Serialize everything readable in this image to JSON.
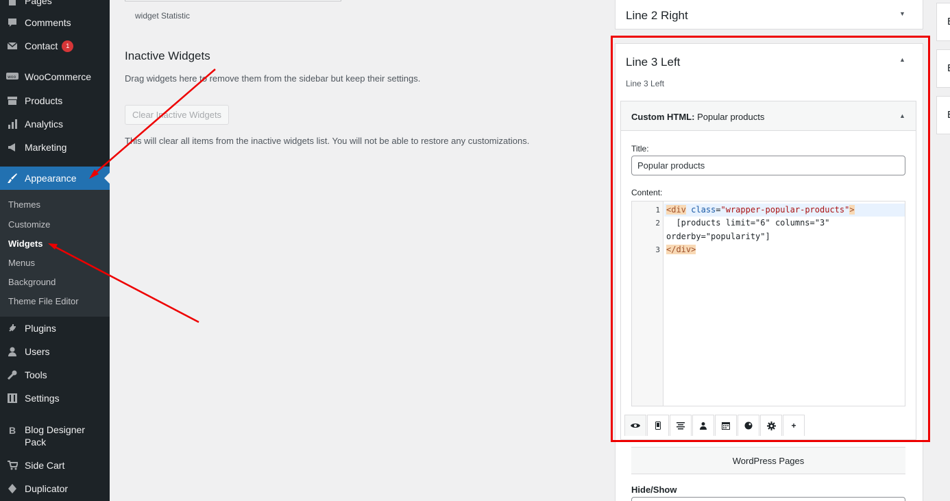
{
  "admin_menu": {
    "items": [
      {
        "key": "pages",
        "label": "Pages",
        "icon": "pages-icon"
      },
      {
        "key": "comments",
        "label": "Comments",
        "icon": "comment-icon"
      },
      {
        "key": "contact",
        "label": "Contact",
        "icon": "mail-icon",
        "badge": "1"
      },
      {
        "key": "woocommerce",
        "label": "WooCommerce",
        "icon": "woocommerce-icon"
      },
      {
        "key": "products",
        "label": "Products",
        "icon": "archive-icon"
      },
      {
        "key": "analytics",
        "label": "Analytics",
        "icon": "bar-chart-icon"
      },
      {
        "key": "marketing",
        "label": "Marketing",
        "icon": "megaphone-icon"
      },
      {
        "key": "appearance",
        "label": "Appearance",
        "icon": "paintbrush-icon",
        "active": true
      },
      {
        "key": "plugins",
        "label": "Plugins",
        "icon": "plug-icon"
      },
      {
        "key": "users",
        "label": "Users",
        "icon": "user-icon"
      },
      {
        "key": "tools",
        "label": "Tools",
        "icon": "wrench-icon"
      },
      {
        "key": "settings",
        "label": "Settings",
        "icon": "settings-icon"
      },
      {
        "key": "blog_designer",
        "label": "Blog Designer Pack",
        "icon": "b-letter-icon"
      },
      {
        "key": "side_cart",
        "label": "Side Cart",
        "icon": "cart-icon"
      },
      {
        "key": "duplicator",
        "label": "Duplicator",
        "icon": "duplicator-icon"
      }
    ],
    "submenu": [
      {
        "label": "Themes"
      },
      {
        "label": "Customize"
      },
      {
        "label": "Widgets",
        "current": true
      },
      {
        "label": "Menus"
      },
      {
        "label": "Background"
      },
      {
        "label": "Theme File Editor"
      }
    ]
  },
  "main": {
    "widget_desc": "widget Statistic",
    "inactive_title": "Inactive Widgets",
    "inactive_desc": "Drag widgets here to remove them from the sidebar but keep their settings.",
    "clear_button": "Clear Inactive Widgets",
    "clear_note": "This will clear all items from the inactive widgets list. You will not be able to restore any customizations."
  },
  "right": {
    "line2_title": "Line 2 Right",
    "line3_title": "Line 3 Left",
    "line3_desc": "Line 3 Left",
    "widget": {
      "type_label": "Custom HTML:",
      "name": "Popular products",
      "title_label": "Title:",
      "title_value": "Popular products",
      "content_label": "Content:",
      "code": {
        "line_numbers": [
          "1",
          "2",
          "3"
        ],
        "line1_open": "<div",
        "line1_attr": "class",
        "line1_eq": "=",
        "line1_val": "\"wrapper-popular-products\"",
        "line1_close": ">",
        "line2a": "  [products limit=\"6\" columns=\"3\"",
        "line2b": "orderby=\"popularity\"]",
        "line3": "</div>"
      },
      "tabs": [
        {
          "icon": "eye-icon",
          "glyph": "👁"
        },
        {
          "icon": "mobile-icon",
          "glyph": "▯"
        },
        {
          "icon": "align-center-icon",
          "glyph": "≡"
        },
        {
          "icon": "user-icon",
          "glyph": "●"
        },
        {
          "icon": "calendar-icon",
          "glyph": "▦"
        },
        {
          "icon": "palette-icon",
          "glyph": "◕"
        },
        {
          "icon": "gear-icon",
          "glyph": "⚙"
        },
        {
          "icon": "plus-icon",
          "glyph": "+"
        }
      ],
      "wp_pages_label": "WordPress Pages",
      "hide_show_label": "Hide/Show"
    },
    "far_right_letters": [
      "E",
      "E",
      "E"
    ]
  },
  "colors": {
    "sidebar_bg": "#1d2327",
    "active_blue": "#2271b1",
    "highlight_red": "#e00"
  }
}
